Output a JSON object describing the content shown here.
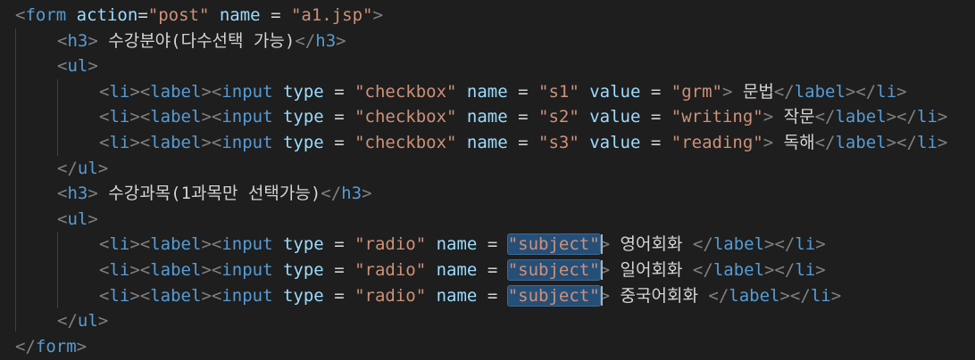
{
  "editor": {
    "lines": [
      {
        "indent": 0,
        "tokens": [
          [
            "t",
            "<"
          ],
          [
            "tag",
            "form"
          ],
          [
            "sp",
            " "
          ],
          [
            "attr",
            "action"
          ],
          [
            "eq",
            "="
          ],
          [
            "str",
            "\"post\""
          ],
          [
            "sp",
            " "
          ],
          [
            "attr",
            "name"
          ],
          [
            "eq",
            " = "
          ],
          [
            "str",
            "\"a1.jsp\""
          ],
          [
            "t",
            ">"
          ]
        ]
      },
      {
        "indent": 1,
        "tokens": [
          [
            "t",
            "<"
          ],
          [
            "tag",
            "h3"
          ],
          [
            "t",
            ">"
          ],
          [
            "txt",
            " 수강분야(다수선택 가능)"
          ],
          [
            "t",
            "</"
          ],
          [
            "tag",
            "h3"
          ],
          [
            "t",
            ">"
          ]
        ]
      },
      {
        "indent": 1,
        "tokens": [
          [
            "t",
            "<"
          ],
          [
            "tag",
            "ul"
          ],
          [
            "t",
            ">"
          ]
        ]
      },
      {
        "indent": 2,
        "tokens": [
          [
            "t",
            "<"
          ],
          [
            "tag",
            "li"
          ],
          [
            "t",
            "><"
          ],
          [
            "tag",
            "label"
          ],
          [
            "t",
            "><"
          ],
          [
            "tag",
            "input"
          ],
          [
            "sp",
            " "
          ],
          [
            "attr",
            "type"
          ],
          [
            "eq",
            " = "
          ],
          [
            "str",
            "\"checkbox\""
          ],
          [
            "sp",
            " "
          ],
          [
            "attr",
            "name"
          ],
          [
            "eq",
            " = "
          ],
          [
            "str",
            "\"s1\""
          ],
          [
            "sp",
            " "
          ],
          [
            "attr",
            "value"
          ],
          [
            "eq",
            " = "
          ],
          [
            "str",
            "\"grm\""
          ],
          [
            "t",
            ">"
          ],
          [
            "txt",
            " 문법"
          ],
          [
            "t",
            "</"
          ],
          [
            "tag",
            "label"
          ],
          [
            "t",
            "></"
          ],
          [
            "tag",
            "li"
          ],
          [
            "t",
            ">"
          ]
        ]
      },
      {
        "indent": 2,
        "tokens": [
          [
            "t",
            "<"
          ],
          [
            "tag",
            "li"
          ],
          [
            "t",
            "><"
          ],
          [
            "tag",
            "label"
          ],
          [
            "t",
            "><"
          ],
          [
            "tag",
            "input"
          ],
          [
            "sp",
            " "
          ],
          [
            "attr",
            "type"
          ],
          [
            "eq",
            " = "
          ],
          [
            "str",
            "\"checkbox\""
          ],
          [
            "sp",
            " "
          ],
          [
            "attr",
            "name"
          ],
          [
            "eq",
            " = "
          ],
          [
            "str",
            "\"s2\""
          ],
          [
            "sp",
            " "
          ],
          [
            "attr",
            "value"
          ],
          [
            "eq",
            " = "
          ],
          [
            "str",
            "\"writing\""
          ],
          [
            "t",
            ">"
          ],
          [
            "txt",
            " 작문"
          ],
          [
            "t",
            "</"
          ],
          [
            "tag",
            "label"
          ],
          [
            "t",
            "></"
          ],
          [
            "tag",
            "li"
          ],
          [
            "t",
            ">"
          ]
        ]
      },
      {
        "indent": 2,
        "tokens": [
          [
            "t",
            "<"
          ],
          [
            "tag",
            "li"
          ],
          [
            "t",
            "><"
          ],
          [
            "tag",
            "label"
          ],
          [
            "t",
            "><"
          ],
          [
            "tag",
            "input"
          ],
          [
            "sp",
            " "
          ],
          [
            "attr",
            "type"
          ],
          [
            "eq",
            " = "
          ],
          [
            "str",
            "\"checkbox\""
          ],
          [
            "sp",
            " "
          ],
          [
            "attr",
            "name"
          ],
          [
            "eq",
            " = "
          ],
          [
            "str",
            "\"s3\""
          ],
          [
            "sp",
            " "
          ],
          [
            "attr",
            "value"
          ],
          [
            "eq",
            " = "
          ],
          [
            "str",
            "\"reading\""
          ],
          [
            "t",
            ">"
          ],
          [
            "txt",
            " 독해"
          ],
          [
            "t",
            "</"
          ],
          [
            "tag",
            "label"
          ],
          [
            "t",
            "></"
          ],
          [
            "tag",
            "li"
          ],
          [
            "t",
            ">"
          ]
        ]
      },
      {
        "indent": 1,
        "tokens": [
          [
            "t",
            "</"
          ],
          [
            "tag",
            "ul"
          ],
          [
            "t",
            ">"
          ]
        ]
      },
      {
        "indent": 1,
        "tokens": [
          [
            "t",
            "<"
          ],
          [
            "tag",
            "h3"
          ],
          [
            "t",
            ">"
          ],
          [
            "txt",
            " 수강과목(1과목만 선택가능)"
          ],
          [
            "t",
            "</"
          ],
          [
            "tag",
            "h3"
          ],
          [
            "t",
            ">"
          ]
        ]
      },
      {
        "indent": 1,
        "tokens": [
          [
            "t",
            "<"
          ],
          [
            "tag",
            "ul"
          ],
          [
            "t",
            ">"
          ]
        ]
      },
      {
        "indent": 2,
        "tokens": [
          [
            "t",
            "<"
          ],
          [
            "tag",
            "li"
          ],
          [
            "t",
            "><"
          ],
          [
            "tag",
            "label"
          ],
          [
            "t",
            "><"
          ],
          [
            "tag",
            "input"
          ],
          [
            "sp",
            " "
          ],
          [
            "attr",
            "type"
          ],
          [
            "eq",
            " = "
          ],
          [
            "str",
            "\"radio\""
          ],
          [
            "sp",
            " "
          ],
          [
            "attr",
            "name"
          ],
          [
            "eq",
            " = "
          ],
          [
            "hl",
            "\"subject\""
          ],
          [
            "t",
            ">"
          ],
          [
            "txt",
            " 영어회화 "
          ],
          [
            "t",
            "</"
          ],
          [
            "tag",
            "label"
          ],
          [
            "t",
            "></"
          ],
          [
            "tag",
            "li"
          ],
          [
            "t",
            ">"
          ]
        ]
      },
      {
        "indent": 2,
        "tokens": [
          [
            "t",
            "<"
          ],
          [
            "tag",
            "li"
          ],
          [
            "t",
            "><"
          ],
          [
            "tag",
            "label"
          ],
          [
            "t",
            "><"
          ],
          [
            "tag",
            "input"
          ],
          [
            "sp",
            " "
          ],
          [
            "attr",
            "type"
          ],
          [
            "eq",
            " = "
          ],
          [
            "str",
            "\"radio\""
          ],
          [
            "sp",
            " "
          ],
          [
            "attr",
            "name"
          ],
          [
            "eq",
            " = "
          ],
          [
            "hl",
            "\"subject\""
          ],
          [
            "t",
            ">"
          ],
          [
            "txt",
            " 일어회화 "
          ],
          [
            "t",
            "</"
          ],
          [
            "tag",
            "label"
          ],
          [
            "t",
            "></"
          ],
          [
            "tag",
            "li"
          ],
          [
            "t",
            ">"
          ]
        ]
      },
      {
        "indent": 2,
        "tokens": [
          [
            "t",
            "<"
          ],
          [
            "tag",
            "li"
          ],
          [
            "t",
            "><"
          ],
          [
            "tag",
            "label"
          ],
          [
            "t",
            "><"
          ],
          [
            "tag",
            "input"
          ],
          [
            "sp",
            " "
          ],
          [
            "attr",
            "type"
          ],
          [
            "eq",
            " = "
          ],
          [
            "str",
            "\"radio\""
          ],
          [
            "sp",
            " "
          ],
          [
            "attr",
            "name"
          ],
          [
            "eq",
            " = "
          ],
          [
            "hl",
            "\"subject\""
          ],
          [
            "t",
            ">"
          ],
          [
            "txt",
            " 중국어회화 "
          ],
          [
            "t",
            "</"
          ],
          [
            "tag",
            "label"
          ],
          [
            "t",
            "></"
          ],
          [
            "tag",
            "li"
          ],
          [
            "t",
            ">"
          ]
        ]
      },
      {
        "indent": 1,
        "tokens": [
          [
            "t",
            "</"
          ],
          [
            "tag",
            "ul"
          ],
          [
            "t",
            ">"
          ]
        ]
      },
      {
        "indent": 0,
        "tokens": [
          [
            "t",
            "</"
          ],
          [
            "tag",
            "form"
          ],
          [
            "t",
            ">"
          ]
        ]
      }
    ],
    "colors": {
      "background": "#1e1e1e",
      "tag": "#569cd6",
      "attribute": "#9cdcfe",
      "string": "#ce9178",
      "punctuation": "#808080",
      "selection": "#264f78"
    }
  }
}
